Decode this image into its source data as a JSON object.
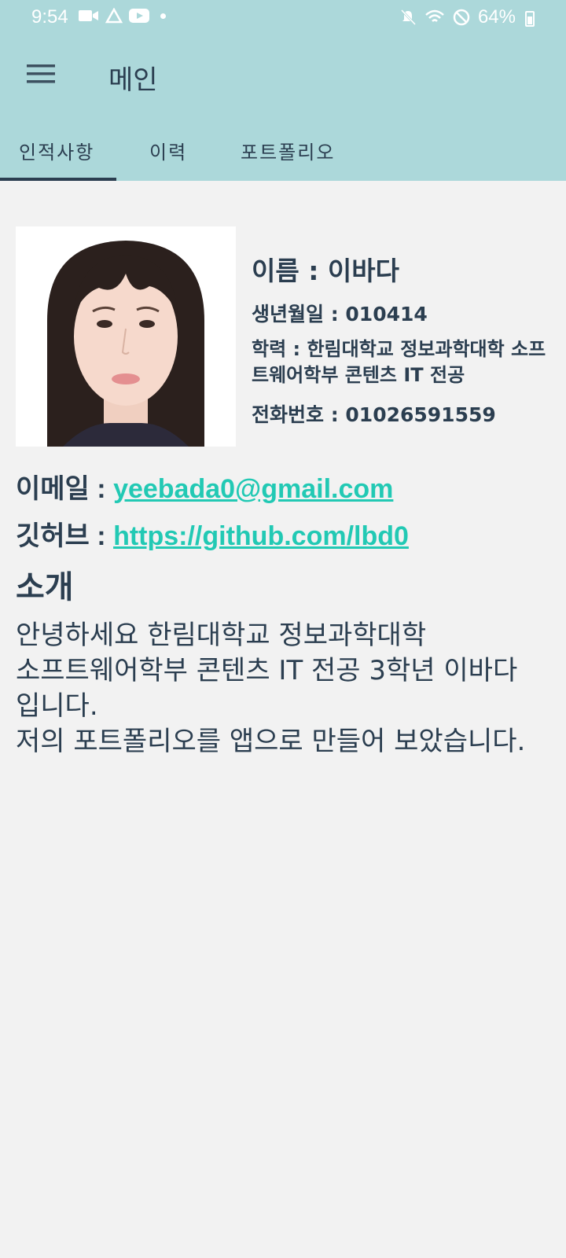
{
  "status_bar": {
    "time": "9:54",
    "battery": "64%",
    "icons_left": [
      "video-icon",
      "drive-icon",
      "youtube-icon",
      "dot-icon"
    ],
    "icons_right": [
      "mute-icon",
      "wifi-icon",
      "dnd-icon",
      "battery-icon"
    ]
  },
  "app_bar": {
    "title": "메인"
  },
  "tabs": [
    {
      "label": "인적사항",
      "selected": true
    },
    {
      "label": "이력",
      "selected": false
    },
    {
      "label": "포트폴리오",
      "selected": false
    }
  ],
  "profile": {
    "name": "이름 : 이바다",
    "birth": "생년월일 : 010414",
    "education": "학력 : 한림대학교 정보과학대학 소프트웨어학부 콘텐츠 IT 전공",
    "phone": "전화번호 : 01026591559",
    "email_label": "이메일 : ",
    "email": "yeebada0@gmail.com",
    "github_label": "깃허브 : ",
    "github": "https://github.com/lbd0"
  },
  "intro": {
    "title": "소개",
    "text": "안녕하세요 한림대학교 정보과학대학\n소프트웨어학부 콘텐츠 IT 전공 3학년 이바다\n입니다.\n저의 포트폴리오를 앱으로 만들어 보았습니다."
  },
  "colors": {
    "header": "#acd8da",
    "text": "#2b3e50",
    "link": "#22c9b4",
    "background": "#f2f2f2"
  }
}
